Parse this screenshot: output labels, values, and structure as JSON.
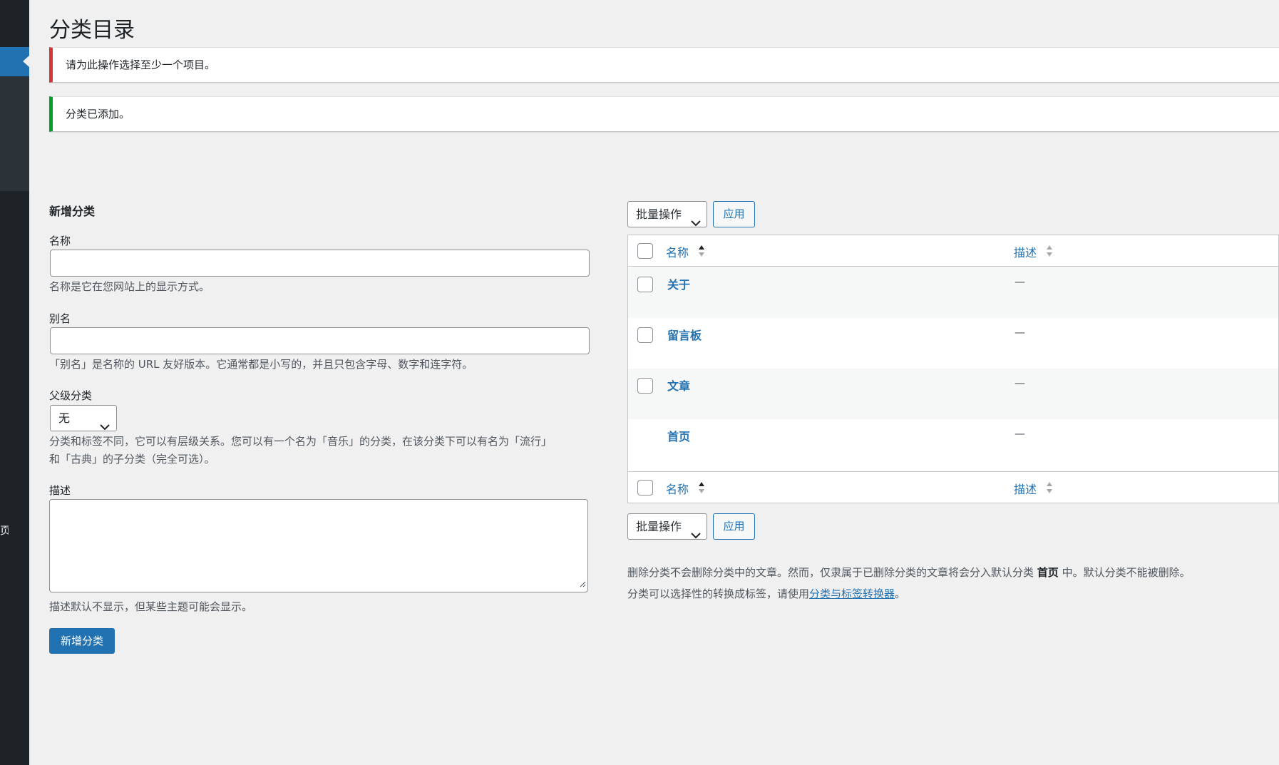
{
  "page": {
    "title": "分类目录"
  },
  "notices": {
    "error": "请为此操作选择至少一个项目。",
    "success": "分类已添加。"
  },
  "sidebar": {
    "partial_text": "页"
  },
  "form": {
    "heading": "新增分类",
    "name_label": "名称",
    "name_value": "",
    "name_help": "名称是它在您网站上的显示方式。",
    "slug_label": "别名",
    "slug_value": "",
    "slug_help": "「别名」是名称的 URL 友好版本。它通常都是小写的，并且只包含字母、数字和连字符。",
    "parent_label": "父级分类",
    "parent_selected": "无",
    "parent_help_line1": "分类和标签不同，它可以有层级关系。您可以有一个名为「音乐」的分类，在该分类下可以有名为「流行」",
    "parent_help_line2": "和「古典」的子分类（完全可选）。",
    "desc_label": "描述",
    "desc_value": "",
    "desc_help": "描述默认不显示，但某些主题可能会显示。",
    "submit_label": "新增分类"
  },
  "table": {
    "bulk_actions_label": "批量操作",
    "apply_label": "应用",
    "columns": [
      "名称",
      "描述"
    ],
    "rows": [
      {
        "name": "关于",
        "desc": "—",
        "has_checkbox": true
      },
      {
        "name": "留言板",
        "desc": "—",
        "has_checkbox": true
      },
      {
        "name": "文章",
        "desc": "—",
        "has_checkbox": true
      },
      {
        "name": "首页",
        "desc": "—",
        "has_checkbox": false
      }
    ]
  },
  "info": {
    "line1_pre": "删除分类不会删除分类中的文章。然而，仅隶属于已删除分类的文章将会分入默认分类 ",
    "line1_bold": "首页",
    "line1_post": " 中。默认分类不能被删除。",
    "line2_pre": "分类可以选择性的转换成标签，请使用",
    "line2_link": "分类与标签转换器",
    "line2_post": "。"
  },
  "colors": {
    "accent": "#2271b1",
    "sidebar_bg": "#1d2327",
    "error": "#d63638",
    "success": "#00a32a",
    "background": "#f0f0f1"
  }
}
